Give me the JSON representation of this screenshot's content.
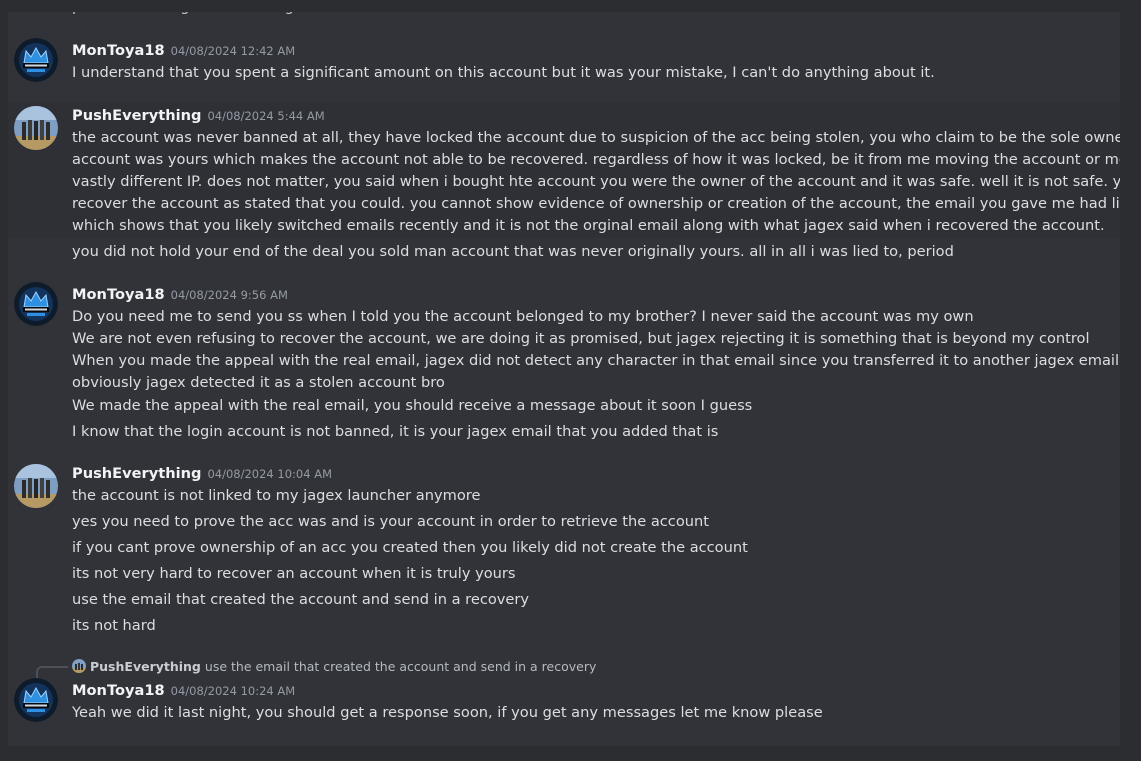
{
  "top_partial_text": "placed or changed for the original was banned mate",
  "messages": [
    {
      "username": "MonToya18",
      "timestamp": "04/08/2024 12:42 AM",
      "lines": [
        "I understand that you spent a significant amount on this account but it was your mistake, I can't do anything about it."
      ]
    },
    {
      "username": "PushEverything",
      "timestamp": "04/08/2024 5:44 AM",
      "lines": [
        "the account was never banned at all, they have locked the account due to suspicion of the acc being stolen, you who claim to be the sole owner cannot prov",
        "account was yours which makes the account not able to be recovered. regardless of how it was locked, be it from me moving the account or me solely playin",
        "vastly different IP. does not matter, you said when i bought hte account you were the owner of the account and it was safe. well it is not safe. you cannot pro",
        "recover the account as stated that you could. you cannot show evidence of ownership or creation of the account, the email you gave me had literally no ema",
        "which shows that you likely switched emails recently and it is not the orginal email along with what jagex said when i recovered the account.",
        "you did not hold your end of the deal you sold man account that was never originally yours. all in all i was lied to, period"
      ]
    },
    {
      "username": "MonToya18",
      "timestamp": "04/08/2024 9:56 AM",
      "lines": [
        "Do you need me to send you ss when I told you the account belonged to my brother? I never said the account was my own",
        "We are not even refusing to recover the account, we are doing it as promised, but jagex rejecting it is something that is beyond my control",
        "When you made the appeal with the real email, jagex did not detect any character in that email since you transferred it to another jagex email that you owne",
        "obviously jagex detected it as a stolen account bro",
        "We made the appeal with the real email, you should receive a message about it soon I guess",
        "I know that the login account is not banned, it is your jagex email that you added that is"
      ]
    },
    {
      "username": "PushEverything",
      "timestamp": "04/08/2024 10:04 AM",
      "lines": [
        "the account is not linked to my jagex launcher anymore",
        "yes you need to prove the acc was and is your account in order to retrieve the account",
        "if you cant prove ownership of an acc you created then you likely did not create the account",
        "its not very hard to recover an account when it is truly yours",
        "use the email that created the account and send in a recovery",
        "its not hard"
      ]
    },
    {
      "username": "MonToya18",
      "timestamp": "04/08/2024 10:24 AM",
      "reply": {
        "username": "PushEverything",
        "text": "use the email that created the account and send in a recovery"
      },
      "lines": [
        "Yeah we did it last night, you should get a response soon, if you get any messages let me know please"
      ]
    }
  ],
  "colors": {
    "background": "#313338",
    "frame": "#2b2d31",
    "text": "#dbdee1",
    "username": "#f2f3f5",
    "timestamp": "#949ba4"
  },
  "icons": {
    "montoya_avatar": "montoya-services-crown-avatar",
    "push_avatar": "group-photo-avatar"
  }
}
